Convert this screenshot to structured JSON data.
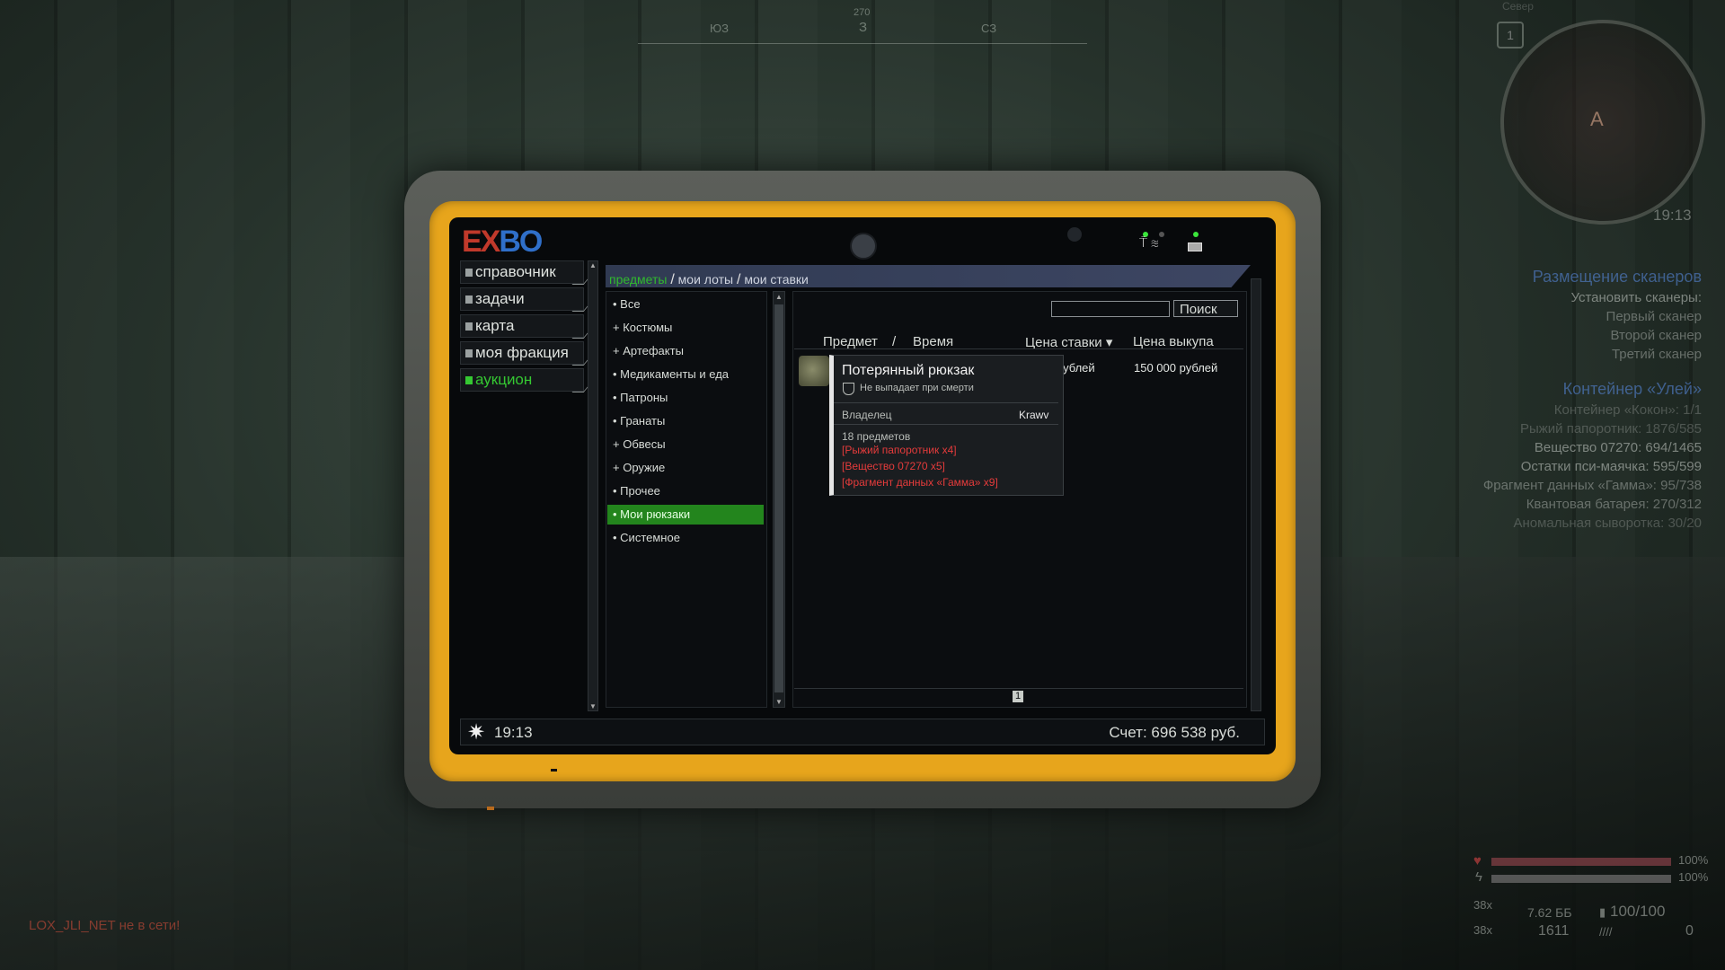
{
  "compass": {
    "left": "ЮЗ",
    "center": "З",
    "right": "СЗ",
    "top": "270"
  },
  "minimap": {
    "level": "1",
    "north": "Север",
    "time": "19:13",
    "player_marker": "A"
  },
  "quests": [
    {
      "title": "Размещение сканеров",
      "items": [
        {
          "text": "Установить сканеры:",
          "tone": "normal"
        },
        {
          "text": "Первый сканер",
          "tone": "mid"
        },
        {
          "text": "Второй сканер",
          "tone": "mid"
        },
        {
          "text": "Третий сканер",
          "tone": "mid"
        }
      ]
    },
    {
      "title": "Контейнер «Улей»",
      "items": [
        {
          "text": "Контейнер «Кокон»: 1/1",
          "tone": "dim"
        },
        {
          "text": "Рыжий папоротник: 1876/585",
          "tone": "dim"
        },
        {
          "text": "Вещество 07270: 694/1465",
          "tone": "normal"
        },
        {
          "text": "Остатки пси-маячка: 595/599",
          "tone": "normal"
        },
        {
          "text": "Фрагмент данных «Гамма»: 95/738",
          "tone": "mid"
        },
        {
          "text": "Квантовая батарея: 270/312",
          "tone": "mid"
        },
        {
          "text": "Аномальная сыворотка: 30/20",
          "tone": "dim"
        }
      ]
    }
  ],
  "chat": {
    "message": "LOX_JLI_NET не в сети!"
  },
  "hud": {
    "health": "100%",
    "stamina": "100%",
    "ammo_type": "7.62 ББ",
    "ammo_count": "1611",
    "mag": "100/100",
    "grenades": "0",
    "slot1": "38x",
    "slot2": "38x",
    "health_fraction": 1.0,
    "stamina_fraction": 1.0
  },
  "tablet": {
    "logo_left": "EX",
    "logo_right": "BO",
    "sidebar": [
      {
        "label": "справочник",
        "active": false
      },
      {
        "label": "задачи",
        "active": false
      },
      {
        "label": "карта",
        "active": false
      },
      {
        "label": "моя фракция",
        "active": false
      },
      {
        "label": "аукцион",
        "active": true
      }
    ],
    "breadcrumb": {
      "first": "предметы",
      "second": "мои лоты",
      "third": "мои ставки",
      "sep": "/"
    },
    "categories": [
      {
        "label": "• Все",
        "active": false
      },
      {
        "label": "+ Костюмы",
        "active": false
      },
      {
        "label": "+ Артефакты",
        "active": false
      },
      {
        "label": "• Медикаменты и еда",
        "active": false
      },
      {
        "label": "• Патроны",
        "active": false
      },
      {
        "label": "• Гранаты",
        "active": false
      },
      {
        "label": "+ Обвесы",
        "active": false
      },
      {
        "label": "+ Оружие",
        "active": false
      },
      {
        "label": "• Прочее",
        "active": false
      },
      {
        "label": "• Мои рюкзаки",
        "active": true
      },
      {
        "label": "• Системное",
        "active": false
      }
    ],
    "search": {
      "button": "Поиск",
      "value": ""
    },
    "columns": {
      "item": "Предмет",
      "slash": "/",
      "time": "Время",
      "bid": "Цена ставки ▾",
      "buyout": "Цена выкупа"
    },
    "row": {
      "bid": "рублей",
      "buyout": "150 000 рублей"
    },
    "tooltip": {
      "title": "Потерянный рюкзак",
      "subtitle": "Не выпадает при смерти",
      "owner_label": "Владелец",
      "owner": "Krawv",
      "count": "18 предметов",
      "items": [
        "[Рыжий папоротник x4]",
        "[Вещество 07270 x5]",
        "[Фрагмент данных «Гамма» x9]"
      ]
    },
    "page": "1",
    "status": {
      "time": "19:13",
      "account": "Счет: 696 538 руб."
    }
  },
  "colors": {
    "accent_green": "#35c832",
    "tablet_yellow": "#e7a51c",
    "red_text": "#e53b3b",
    "breadcrumb_bar": "#3d4663"
  }
}
